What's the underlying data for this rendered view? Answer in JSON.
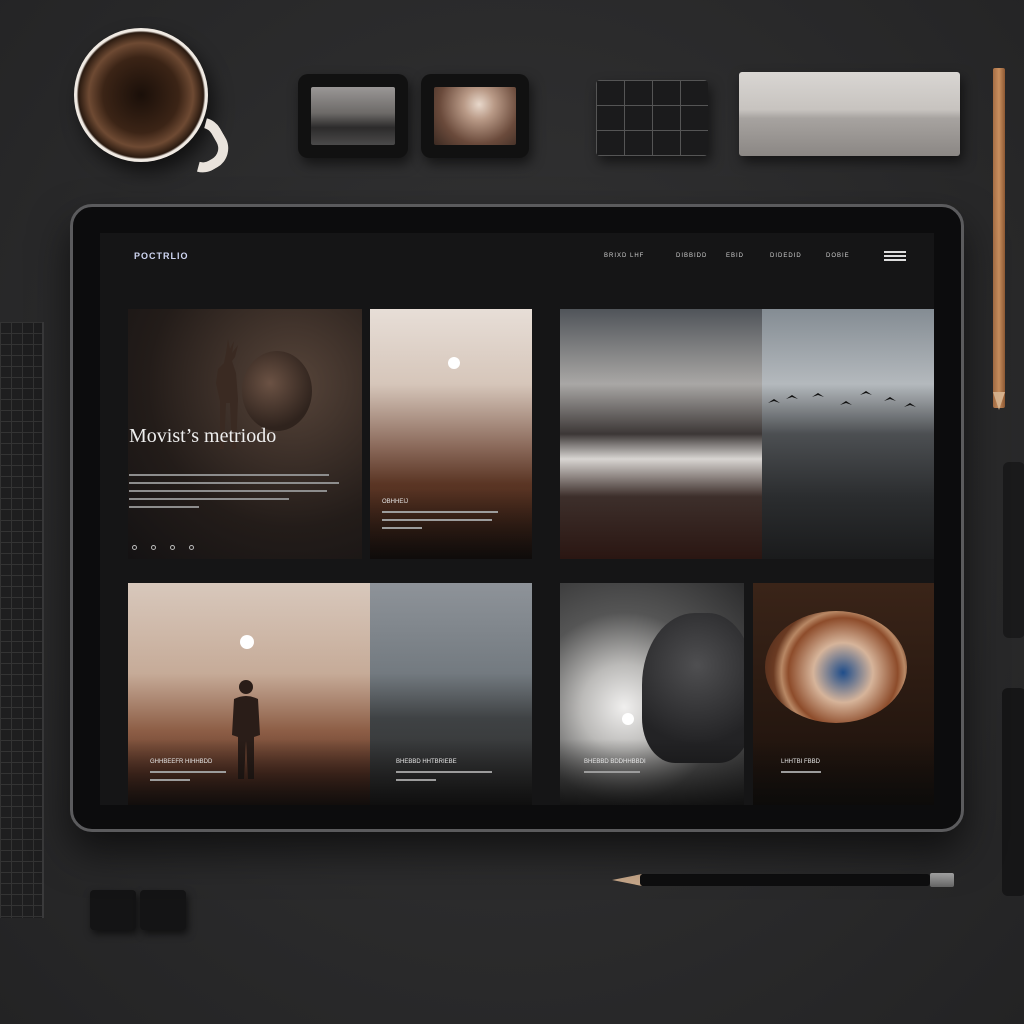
{
  "app": {
    "logo": "POCTRLIO",
    "menu": [
      "BRIXD  LHF",
      "DIBBIDD",
      "EBID",
      "DIDEDID",
      "DOBIE"
    ],
    "hero": {
      "title": "Movist’s metriodo"
    },
    "captions": {
      "sun1": "OBHHEIJ",
      "walker": "GHHBEEFR HIHHBDD",
      "coast": "BHEBBD HHTBRIEBE",
      "bird": "BHEBBD BDDHHBBDI",
      "bowl": "LHHTBI FBBD"
    }
  },
  "colors": {
    "accent": "#cfd6f2",
    "background": "#151516",
    "frame": "#0c0c0d"
  },
  "icons": {
    "menu": "hamburger-icon",
    "dots": "pagination-dots-icon"
  }
}
